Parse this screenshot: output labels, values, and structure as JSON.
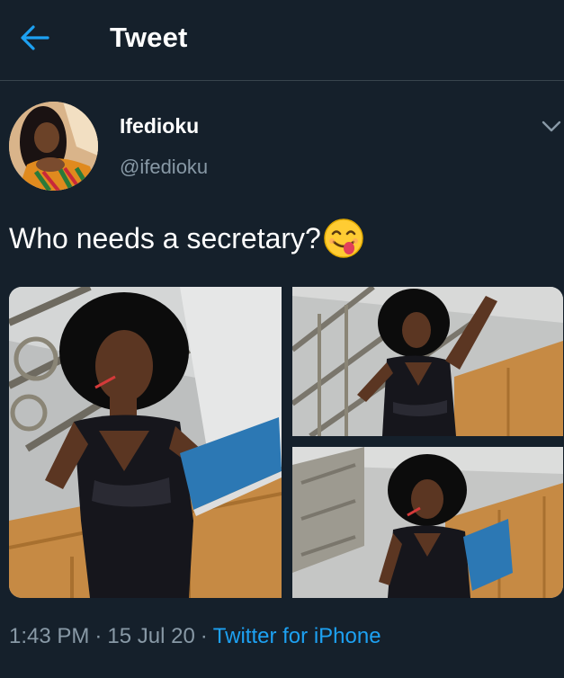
{
  "header": {
    "title": "Tweet",
    "back_icon": "arrow-left-icon"
  },
  "author": {
    "display_name": "Ifedioku",
    "handle": "@ifedioku"
  },
  "tweet": {
    "text": "Who needs a secretary?",
    "emoji": "face-savoring-food-emoji"
  },
  "meta": {
    "time": "1:43 PM",
    "separator": "·",
    "date": "15 Jul 20",
    "source": "Twitter for iPhone"
  },
  "colors": {
    "background": "#15202b",
    "accent": "#1da1f2",
    "secondary_text": "#8899a6",
    "divider": "#38444d"
  }
}
